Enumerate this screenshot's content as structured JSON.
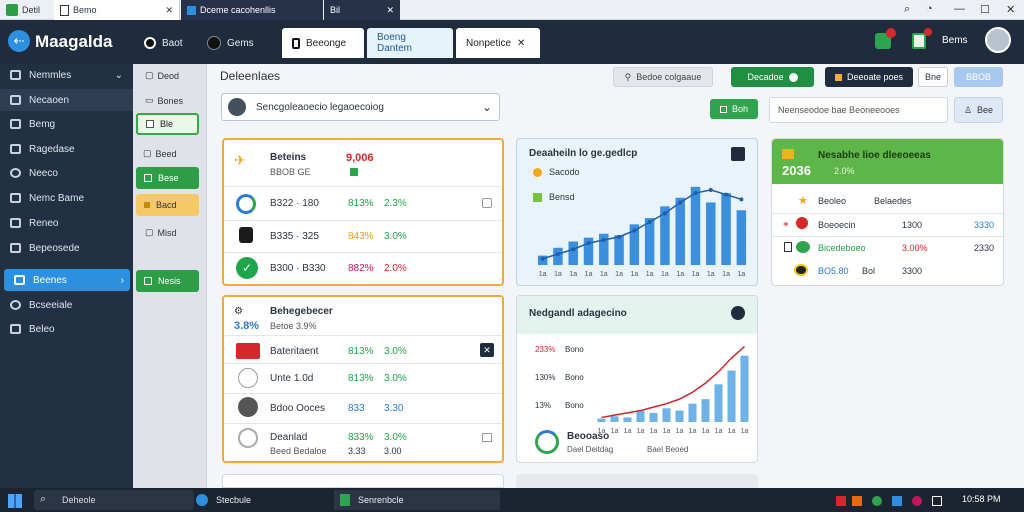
{
  "titlebar": {
    "app_label": "Detil",
    "tabs": [
      {
        "label": "Bemo"
      },
      {
        "label": "Dceme cacohenllis"
      },
      {
        "label": "Bil"
      }
    ]
  },
  "header": {
    "app_title": "Maagalda",
    "tabs": [
      {
        "label": "Baot"
      },
      {
        "label": "Gems"
      }
    ],
    "open_tabs": [
      {
        "label": "Beeonge"
      },
      {
        "label": "Boeng Dantem"
      },
      {
        "label": "Nonpetice"
      }
    ],
    "user_label": "Bems"
  },
  "sidebar": {
    "items": [
      {
        "label": "Nemmles"
      },
      {
        "label": "Necaoen"
      },
      {
        "label": "Bemg"
      },
      {
        "label": "Ragedase"
      },
      {
        "label": "Neeco"
      },
      {
        "label": "Nemc Bame"
      },
      {
        "label": "Reneo"
      },
      {
        "label": "Bepeosede"
      },
      {
        "label": "Beenes"
      },
      {
        "label": "Bcseeiale"
      },
      {
        "label": "Beleo"
      }
    ]
  },
  "subsidebar": {
    "items": [
      {
        "label": "Deod"
      },
      {
        "label": "Bones"
      },
      {
        "label": "Ble"
      },
      {
        "label": "Beed"
      },
      {
        "label": "Bese"
      },
      {
        "label": "Bacd"
      },
      {
        "label": "Misd"
      },
      {
        "label": "Nesis"
      }
    ]
  },
  "main": {
    "title": "Deleenlaes",
    "toolbar": {
      "btn_1": "Bedoe colgaaue",
      "btn_2": "Decadoe",
      "btn_3": "Deeoate poes",
      "btn_4": "Bne",
      "btn_5": "BBOB"
    },
    "search": {
      "value": "Sencgoleaoecio legaoecoiog",
      "secondary_btn": "Boh",
      "placeholder": "Neenseodoe bae Beoneeooes",
      "side_btn": "Bee"
    }
  },
  "card1": {
    "header_title": "Beteins",
    "header_sub": "BBOB GE",
    "header_value": "9,006",
    "rows": [
      {
        "name": "B322 · 180",
        "v1": "813%",
        "v2": "2.3%"
      },
      {
        "name": "B335 · 325",
        "v1": "843%",
        "v2": "3.0%"
      },
      {
        "name": "B300 · B330",
        "v1": "882%",
        "v2": "2.0%"
      }
    ]
  },
  "card2": {
    "header_title": "Behegebecer",
    "header_value": "3.8%",
    "header_sub": "Betoe 3.9%",
    "rows": [
      {
        "name": "Bateritaent",
        "v1": "813%",
        "v2": "3.0%"
      },
      {
        "name": "Unte 1.0d",
        "v1": "813%",
        "v2": "3.0%"
      },
      {
        "name": "Bdoo Ooces",
        "v1": "833",
        "v2": "3.30"
      },
      {
        "name": "Deanlad",
        "sub": "Beed Bedaloe",
        "v1": "833%",
        "v2": "3.0%",
        "v3": "3.33",
        "v4": "3.00"
      }
    ]
  },
  "chart1_card": {
    "title": "Deaaheiln lo ge.gedlcp",
    "legend": [
      {
        "label": "Sacodo",
        "color": "#f2a818"
      },
      {
        "label": "Bensd",
        "color": "#7bc142"
      }
    ],
    "tick_labels": [
      "1a",
      "1a",
      "1a",
      "1a",
      "1a",
      "1a",
      "1a",
      "1a",
      "1a",
      "1a",
      "1a",
      "1a",
      "1a",
      "1a"
    ]
  },
  "chart2_card": {
    "title": "Nedgandl adagecino",
    "y_labels": [
      "233%",
      "130%",
      "13%"
    ],
    "y_names": [
      "Bono",
      "Bono",
      "Bono"
    ],
    "footer_title": "Beooaso",
    "footer_sub": "Dael Deitdag",
    "footer_right": "Bael Beoed"
  },
  "card3": {
    "title": "Nesabhe lioe dleeoeeas",
    "big_value": "2036",
    "sub_value": "2.0%",
    "col_1": "Beoleo",
    "col_2": "Belaedes",
    "rows": [
      {
        "name": "Boeoecin",
        "v1": "1300",
        "v2": "3330"
      },
      {
        "name": "Bicedeboeo",
        "v1": "3.00%",
        "v2": "2330"
      },
      {
        "name": "BO5.80",
        "v1": "Bol",
        "v2": "3300"
      }
    ]
  },
  "chart_data": [
    {
      "type": "bar",
      "title": "Deaaheiln lo ge.gedlcp",
      "categories": [
        "1a",
        "1a",
        "1a",
        "1a",
        "1a",
        "1a",
        "1a",
        "1a",
        "1a",
        "1a",
        "1a",
        "1a",
        "1a",
        "1a"
      ],
      "values": [
        12,
        22,
        30,
        35,
        40,
        38,
        52,
        60,
        75,
        86,
        100,
        80,
        92,
        70
      ],
      "line": [
        8,
        14,
        20,
        28,
        32,
        36,
        44,
        55,
        66,
        80,
        92,
        96,
        90,
        84
      ],
      "ylim": [
        0,
        110
      ]
    },
    {
      "type": "bar",
      "title": "Nedgandl adagecino",
      "categories": [
        "1a",
        "1a",
        "1a",
        "1a",
        "1a",
        "1a",
        "1a",
        "1a",
        "1a",
        "1a",
        "1a",
        "1a"
      ],
      "values": [
        3,
        5,
        4,
        10,
        8,
        12,
        10,
        16,
        20,
        33,
        45,
        58
      ],
      "line": [
        4,
        6,
        8,
        10,
        13,
        16,
        20,
        26,
        34,
        44,
        56,
        66
      ],
      "ylim": [
        0,
        70
      ]
    }
  ],
  "taskbar": {
    "search": "Deheole",
    "apps": [
      {
        "label": "Stecbule"
      },
      {
        "label": "Senrenbcle"
      }
    ],
    "time": "10:58 PM"
  }
}
